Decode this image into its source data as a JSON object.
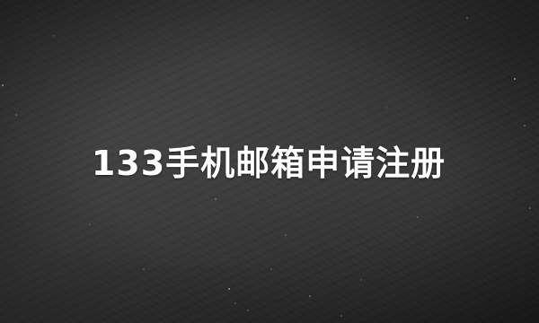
{
  "title": "133手机邮箱申请注册",
  "colors": {
    "background": "#2b2b2b",
    "text": "#ffffff"
  }
}
